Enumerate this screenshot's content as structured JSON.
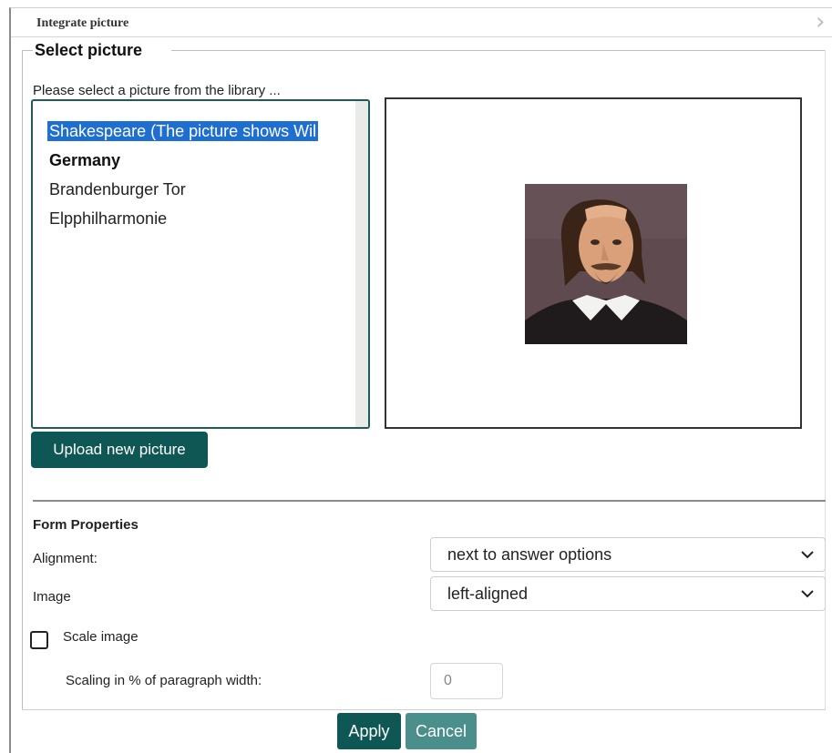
{
  "dialog": {
    "title": "Integrate picture",
    "close_icon": "chevron-right-icon"
  },
  "picture_section": {
    "legend": "Select picture",
    "instruction": "Please select a picture from the library ...",
    "library_items": [
      {
        "label": "Shakespeare (The picture shows Wil",
        "selected": true,
        "group": false
      },
      {
        "label": "Germany",
        "selected": false,
        "group": true
      },
      {
        "label": "Brandenburger Tor",
        "selected": false,
        "group": false
      },
      {
        "label": "Elpphilharmonie",
        "selected": false,
        "group": false
      }
    ],
    "upload_button": "Upload new picture"
  },
  "form_properties": {
    "title": "Form Properties",
    "alignment_label": "Alignment:",
    "alignment_value": "next to answer options",
    "image_label": "Image",
    "image_value": "left-aligned",
    "scale_label": "Scale image",
    "scale_checked": false,
    "scaling_label": "Scaling in % of paragraph width:",
    "scaling_value": "0"
  },
  "footer": {
    "apply": "Apply",
    "cancel": "Cancel"
  },
  "colors": {
    "primary": "#0f5754",
    "secondary": "#4a8f8c",
    "selection": "#1f6fd1"
  }
}
